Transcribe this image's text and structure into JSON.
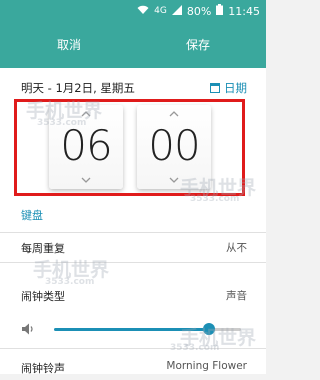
{
  "status_bar": {
    "network": "4G",
    "battery": "80%",
    "time": "11:45"
  },
  "top_bar": {
    "cancel_label": "取消",
    "save_label": "保存"
  },
  "date_row": {
    "date_text": "明天 - 1月2日, 星期五",
    "date_link_label": "日期"
  },
  "time_picker": {
    "hour": "06",
    "minute": "00"
  },
  "keyboard_label": "键盘",
  "settings": [
    {
      "label": "每周重复",
      "value": "从不"
    },
    {
      "label": "闹钟类型",
      "value": "声音"
    }
  ],
  "volume": {
    "level": 0.83
  },
  "ringtone": {
    "label": "闹钟铃声",
    "value": "Morning Flower"
  },
  "watermark_text": "手机世界",
  "watermark_sub": "3533.com",
  "colors": {
    "accent": "#3aa89d",
    "link": "#1b8fb5",
    "highlight": "#e01b1b"
  }
}
